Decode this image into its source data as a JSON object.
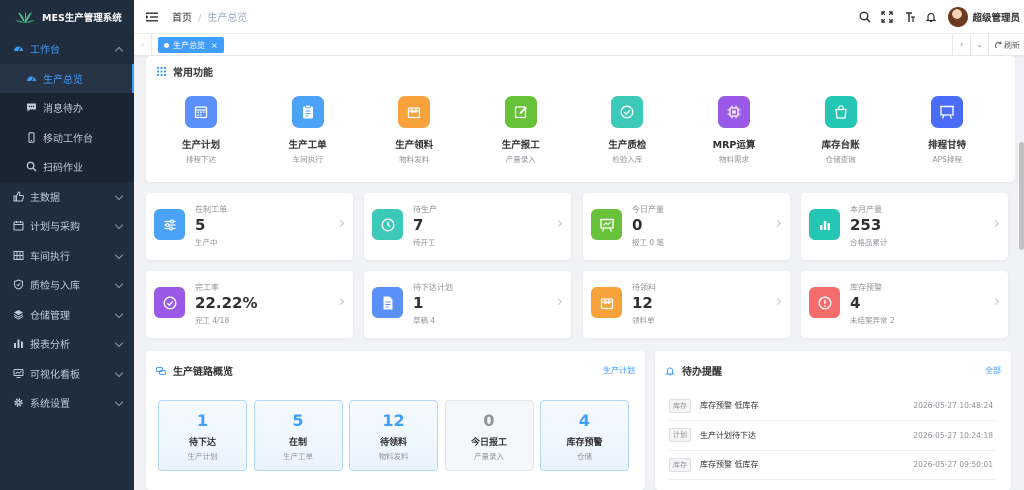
{
  "app": {
    "title": "MES生产管理系统"
  },
  "sidebar": {
    "items": [
      {
        "label": "工作台",
        "icon": "dashboard-icon",
        "expanded": true,
        "active": true,
        "children": [
          {
            "label": "生产总览",
            "icon": "gauge-icon",
            "active": true
          },
          {
            "label": "消息待办",
            "icon": "message-icon"
          },
          {
            "label": "移动工作台",
            "icon": "mobile-icon"
          },
          {
            "label": "扫码作业",
            "icon": "search-icon"
          }
        ]
      },
      {
        "label": "主数据",
        "icon": "thumb-icon"
      },
      {
        "label": "计划与采购",
        "icon": "calendar-icon"
      },
      {
        "label": "车间执行",
        "icon": "grid-icon"
      },
      {
        "label": "质检与入库",
        "icon": "shield-icon"
      },
      {
        "label": "仓储管理",
        "icon": "layers-icon"
      },
      {
        "label": "报表分析",
        "icon": "bar-chart-icon"
      },
      {
        "label": "可视化看板",
        "icon": "monitor-icon"
      },
      {
        "label": "系统设置",
        "icon": "gear-icon"
      }
    ]
  },
  "header": {
    "breadcrumb": [
      "首页",
      "生产总览"
    ],
    "user_name": "超级管理员"
  },
  "tags": {
    "active_tag": "生产总览",
    "refresh_label": "刷新"
  },
  "quick": {
    "title": "常用功能",
    "items": [
      {
        "name": "生产计划",
        "desc": "排程下达",
        "color": "#5b8ff9",
        "icon": "calendar-icon"
      },
      {
        "name": "生产工单",
        "desc": "车间执行",
        "color": "#4ba3f7",
        "icon": "clipboard-icon"
      },
      {
        "name": "生产领料",
        "desc": "物料发料",
        "color": "#f7a23b",
        "icon": "box-icon"
      },
      {
        "name": "生产报工",
        "desc": "产量录入",
        "color": "#67c23a",
        "icon": "edit-icon"
      },
      {
        "name": "生产质检",
        "desc": "检验入库",
        "color": "#3cc9b8",
        "icon": "check-circle-icon"
      },
      {
        "name": "MRP运算",
        "desc": "物料需求",
        "color": "#9b59e8",
        "icon": "chip-icon"
      },
      {
        "name": "库存台账",
        "desc": "仓储查询",
        "color": "#26c6b5",
        "icon": "bag-icon"
      },
      {
        "name": "排程甘特",
        "desc": "APS排程",
        "color": "#4a6cf7",
        "icon": "board-icon"
      }
    ]
  },
  "stats": [
    {
      "label": "在制工单",
      "value": "5",
      "sub": "生产中",
      "color": "#4ba3f7",
      "icon": "sliders-icon"
    },
    {
      "label": "待生产",
      "value": "7",
      "sub": "待开工",
      "color": "#3cc9b8",
      "icon": "clock-icon"
    },
    {
      "label": "今日产量",
      "value": "0",
      "sub": "报工 0 笔",
      "color": "#67c23a",
      "icon": "easel-icon"
    },
    {
      "label": "本月产量",
      "value": "253",
      "sub": "合格品累计",
      "color": "#26c6b5",
      "icon": "bar-chart-icon"
    },
    {
      "label": "完工率",
      "value": "22.22%",
      "sub": "完工 4/18",
      "color": "#9b59e8",
      "icon": "check-circle-icon"
    },
    {
      "label": "待下达计划",
      "value": "1",
      "sub": "草稿 4",
      "color": "#5b8ff9",
      "icon": "document-icon"
    },
    {
      "label": "待领料",
      "value": "12",
      "sub": "领料单",
      "color": "#f7a23b",
      "icon": "box-icon"
    },
    {
      "label": "库存预警",
      "value": "4",
      "sub": "未结案异常 2",
      "color": "#f56c6c",
      "icon": "alert-icon"
    }
  ],
  "chain": {
    "title": "生产链路概览",
    "link": "生产计划",
    "items": [
      {
        "value": "1",
        "name": "待下达",
        "sub": "生产计划"
      },
      {
        "value": "5",
        "name": "在制",
        "sub": "生产工单"
      },
      {
        "value": "12",
        "name": "待领料",
        "sub": "物料发料"
      },
      {
        "value": "0",
        "name": "今日报工",
        "sub": "产量录入"
      },
      {
        "value": "4",
        "name": "库存预警",
        "sub": "仓储"
      }
    ]
  },
  "todo": {
    "title": "待办提醒",
    "link": "全部",
    "items": [
      {
        "tag": "库存",
        "text": "库存预警 低库存",
        "time": "2026-05-27 10:48:24"
      },
      {
        "tag": "计划",
        "text": "生产计划待下达",
        "time": "2026-05-27 10:24:18"
      },
      {
        "tag": "库存",
        "text": "库存预警 低库存",
        "time": "2026-05-27 09:50:01"
      }
    ]
  }
}
